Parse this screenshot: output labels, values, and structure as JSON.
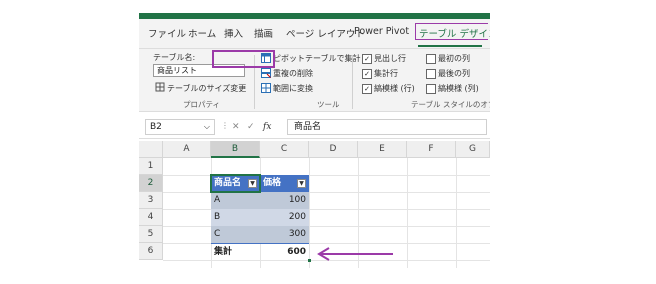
{
  "ribbon_tabs": [
    "ファイル",
    "ホーム",
    "挿入",
    "描画",
    "ページ レイアウト",
    "Power Pivot",
    "テーブル デザイン"
  ],
  "properties": {
    "table_name_label": "テーブル名:",
    "table_name_value": "商品リスト",
    "resize_label": "テーブルのサイズ変更",
    "group_label": "プロパティ"
  },
  "tools": {
    "pivot_label": "ピボットテーブルで集計",
    "dedupe_label": "重複の削除",
    "convert_label": "範囲に変換",
    "group_label": "ツール"
  },
  "style_options": {
    "header_row": {
      "label": "見出し行",
      "checked": true
    },
    "total_row": {
      "label": "集計行",
      "checked": true
    },
    "banded_rows": {
      "label": "縞模様 (行)",
      "checked": true
    },
    "first_column": {
      "label": "最初の列",
      "checked": false
    },
    "last_column": {
      "label": "最後の列",
      "checked": false
    },
    "banded_columns": {
      "label": "縞模様 (列)",
      "checked": false
    },
    "group_label": "テーブル スタイルのオプシ"
  },
  "formula_bar": {
    "name_box": "B2",
    "fx": "fx",
    "content": "商品名"
  },
  "sheet": {
    "columns": [
      "A",
      "B",
      "C",
      "D",
      "E",
      "F",
      "G"
    ],
    "rows": [
      "1",
      "2",
      "3",
      "4",
      "5",
      "6"
    ],
    "table": {
      "headers": [
        "商品名",
        "価格"
      ],
      "rows": [
        {
          "name": "A",
          "price": "100"
        },
        {
          "name": "B",
          "price": "200"
        },
        {
          "name": "C",
          "price": "300"
        }
      ],
      "total_label": "集計",
      "total_value": "600"
    }
  },
  "colors": {
    "excel_green": "#217346",
    "annotation_purple": "#9b3aa8",
    "table_header_blue": "#4472c4"
  }
}
